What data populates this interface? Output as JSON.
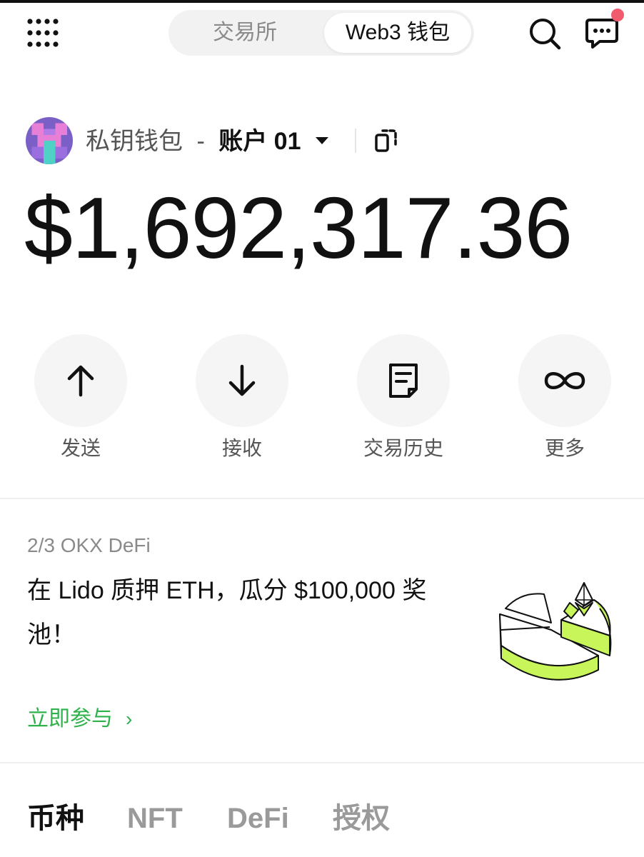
{
  "header": {
    "tabs": [
      {
        "label": "交易所",
        "active": false
      },
      {
        "label": "Web3 钱包",
        "active": true
      }
    ],
    "icons": [
      "apps-grid-icon",
      "search-icon",
      "message-icon"
    ],
    "notification_dot_color": "#f05c6e"
  },
  "account": {
    "wallet_name": "私钥钱包",
    "separator": "-",
    "account_name": "账户 01",
    "balance": "$1,692,317.36"
  },
  "actions": [
    {
      "label": "发送",
      "icon": "arrow-up-icon"
    },
    {
      "label": "接收",
      "icon": "arrow-down-icon"
    },
    {
      "label": "交易历史",
      "icon": "document-icon"
    },
    {
      "label": "更多",
      "icon": "infinity-icon"
    }
  ],
  "promo": {
    "index": "2/3 OKX DeFi",
    "title": "在 Lido 质押 ETH，瓜分 $100,000 奖池！",
    "cta": "立即参与",
    "cta_chevron": "›",
    "accent": "#2fb14b",
    "art_accent": "#c8f55a"
  },
  "asset_tabs": [
    {
      "label": "币种",
      "active": true
    },
    {
      "label": "NFT",
      "active": false
    },
    {
      "label": "DeFi",
      "active": false
    },
    {
      "label": "授权",
      "active": false
    }
  ]
}
